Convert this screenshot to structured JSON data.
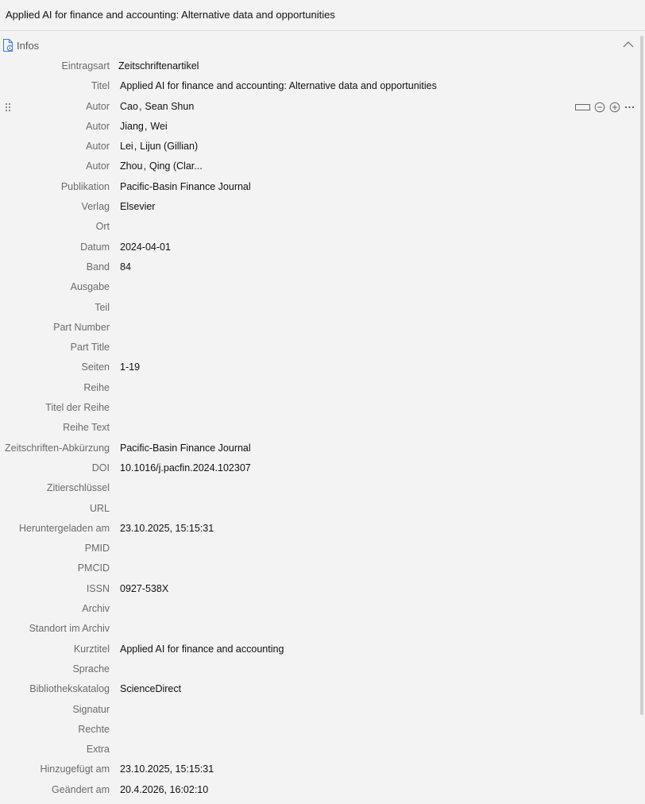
{
  "header": {
    "title": "Applied AI for finance and accounting: Alternative data and opportunities"
  },
  "section": {
    "label": "Infos",
    "icon": "document-info-icon",
    "collapse_icon": "chevron-up-icon"
  },
  "fields": {
    "item_type": {
      "label": "Eintragsart",
      "value": "Zeitschriftenartikel"
    },
    "title": {
      "label": "Titel",
      "value": "Applied AI for finance and accounting: Alternative data and opportunities"
    },
    "creators": [
      {
        "label": "Autor",
        "last": "Cao",
        "first": "Sean Shun"
      },
      {
        "label": "Autor",
        "last": "Jiang",
        "first": "Wei"
      },
      {
        "label": "Autor",
        "last": "Lei",
        "first": "Lijun (Gillian)"
      },
      {
        "label": "Autor",
        "last": "Zhou",
        "first": "Qing (Clar..."
      }
    ],
    "publication": {
      "label": "Publikation",
      "value": "Pacific-Basin Finance Journal"
    },
    "publisher": {
      "label": "Verlag",
      "value": "Elsevier"
    },
    "place": {
      "label": "Ort",
      "value": ""
    },
    "date": {
      "label": "Datum",
      "value": "2024-04-01"
    },
    "volume": {
      "label": "Band",
      "value": "84"
    },
    "issue": {
      "label": "Ausgabe",
      "value": ""
    },
    "part": {
      "label": "Teil",
      "value": ""
    },
    "part_number": {
      "label": "Part Number",
      "value": ""
    },
    "part_title": {
      "label": "Part Title",
      "value": ""
    },
    "pages": {
      "label": "Seiten",
      "value": "1-19"
    },
    "series": {
      "label": "Reihe",
      "value": ""
    },
    "series_title": {
      "label": "Titel der Reihe",
      "value": ""
    },
    "series_text": {
      "label": "Reihe Text",
      "value": ""
    },
    "journal_abbr": {
      "label": "Zeitschriften-Abkürzung",
      "value": "Pacific-Basin Finance Journal"
    },
    "doi": {
      "label": "DOI",
      "value": "10.1016/j.pacfin.2024.102307"
    },
    "citation_key": {
      "label": "Zitierschlüssel",
      "value": ""
    },
    "url": {
      "label": "URL",
      "value": ""
    },
    "accessed": {
      "label": "Heruntergeladen am",
      "value": "23.10.2025, 15:15:31"
    },
    "pmid": {
      "label": "PMID",
      "value": ""
    },
    "pmcid": {
      "label": "PMCID",
      "value": ""
    },
    "issn": {
      "label": "ISSN",
      "value": "0927-538X"
    },
    "archive": {
      "label": "Archiv",
      "value": ""
    },
    "archive_location": {
      "label": "Standort im Archiv",
      "value": ""
    },
    "short_title": {
      "label": "Kurztitel",
      "value": "Applied AI for finance and accounting"
    },
    "language": {
      "label": "Sprache",
      "value": ""
    },
    "library_catalog": {
      "label": "Bibliothekskatalog",
      "value": "ScienceDirect"
    },
    "call_number": {
      "label": "Signatur",
      "value": ""
    },
    "rights": {
      "label": "Rechte",
      "value": ""
    },
    "extra": {
      "label": "Extra",
      "value": ""
    },
    "date_added": {
      "label": "Hinzugefügt am",
      "value": "23.10.2025, 15:15:31"
    },
    "date_modified": {
      "label": "Geändert am",
      "value": "20.4.2026, 16:02:10"
    }
  },
  "creator_actions": {
    "icons": [
      "switch-field-mode-icon",
      "remove-creator-icon",
      "add-creator-icon",
      "more-options-icon"
    ]
  }
}
